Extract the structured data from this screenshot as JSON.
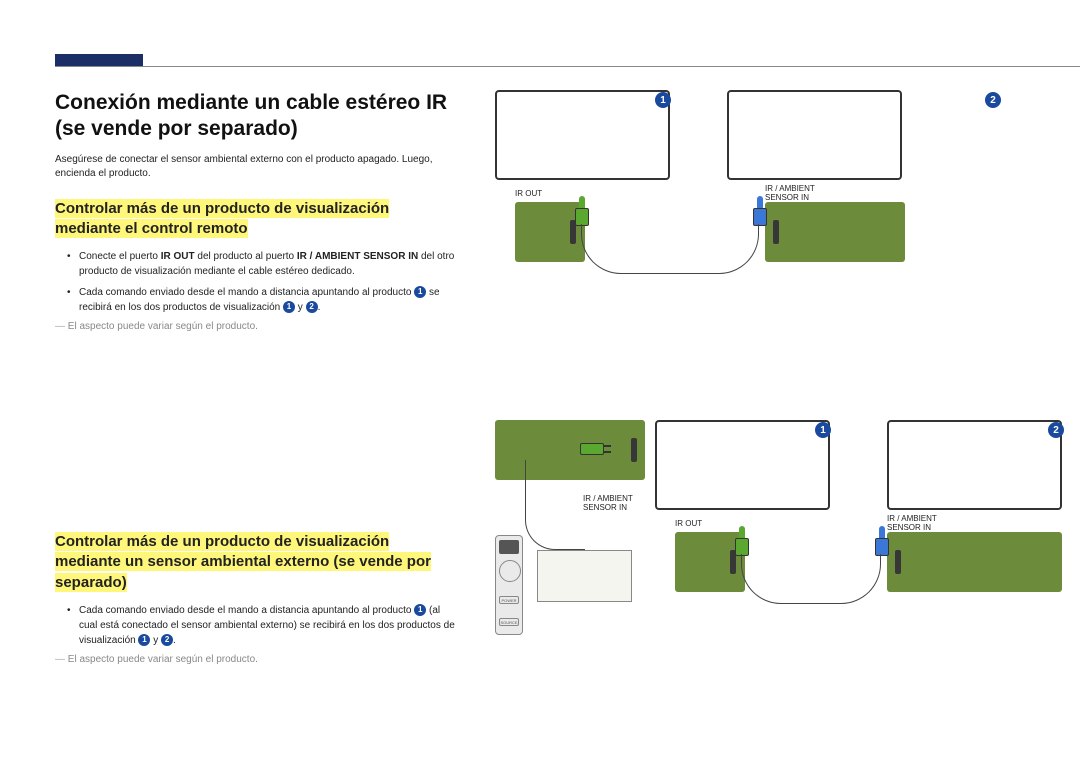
{
  "title": "Conexión mediante un cable estéreo IR (se vende por separado)",
  "intro": "Asegúrese de conectar el sensor ambiental externo con el producto apagado. Luego, encienda el producto.",
  "section1": {
    "heading": "Controlar más de un producto de visualización mediante el control remoto",
    "bullet1_a": "Conecte el puerto ",
    "bullet1_b": "IR OUT",
    "bullet1_c": " del producto al puerto ",
    "bullet1_d": "IR / AMBIENT SENSOR IN",
    "bullet1_e": " del otro producto de visualización mediante el cable estéreo dedicado.",
    "bullet2_a": "Cada comando enviado desde el mando a distancia apuntando al producto ",
    "bullet2_b": " se recibirá en los dos productos de visualización ",
    "bullet2_c": " y ",
    "bullet2_d": ".",
    "note": "El aspecto puede variar según el producto."
  },
  "section2": {
    "heading": "Controlar más de un producto de visualización mediante un sensor ambiental externo (se vende por separado)",
    "bullet1_a": "Cada comando enviado desde el mando a distancia apuntando al producto ",
    "bullet1_b": " (al cual está conectado el sensor ambiental externo) se recibirá en los dos productos de visualización ",
    "bullet1_c": " y ",
    "bullet1_d": ".",
    "note": "El aspecto puede variar según el producto."
  },
  "labels": {
    "ir_out": "IR OUT",
    "ir_ambient": "IR / AMBIENT SENSOR IN",
    "one": "1",
    "two": "2",
    "power": "POWER",
    "source": "SOURCE"
  }
}
